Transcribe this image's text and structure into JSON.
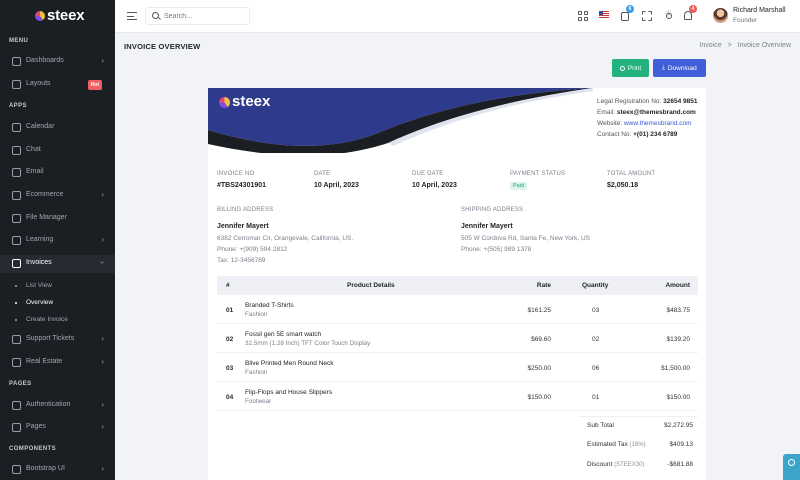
{
  "brand": {
    "name": "steex"
  },
  "sidebar": {
    "sections": [
      "MENU",
      "APPS",
      "PAGES",
      "COMPONENTS"
    ],
    "items": [
      {
        "label": "Dashboards",
        "icon": "dashboard-icon",
        "chevron": true
      },
      {
        "label": "Layouts",
        "icon": "layout-icon",
        "badge": "Hot"
      },
      {
        "label": "Calendar",
        "icon": "calendar-icon"
      },
      {
        "label": "Chat",
        "icon": "chat-icon"
      },
      {
        "label": "Email",
        "icon": "email-icon"
      },
      {
        "label": "Ecommerce",
        "icon": "cart-icon",
        "chevron": true
      },
      {
        "label": "File Manager",
        "icon": "folder-icon"
      },
      {
        "label": "Learning",
        "icon": "learning-icon",
        "chevron": true
      },
      {
        "label": "Invoices",
        "icon": "invoice-icon",
        "chevron": true,
        "active": true
      },
      {
        "label": "Support Tickets",
        "icon": "ticket-icon",
        "chevron": true
      },
      {
        "label": "Real Estate",
        "icon": "building-icon",
        "chevron": true
      },
      {
        "label": "Authentication",
        "icon": "lock-icon",
        "chevron": true
      },
      {
        "label": "Pages",
        "icon": "pages-icon",
        "chevron": true
      },
      {
        "label": "Bootstrap UI",
        "icon": "ui-icon",
        "chevron": true
      }
    ],
    "invoice_subitems": [
      "List View",
      "Overview",
      "Create Invoice"
    ],
    "active_subitem": "Overview"
  },
  "topbar": {
    "search_placeholder": "Search...",
    "cart_count": "6",
    "notification_count": "4",
    "user_name": "Richard Marshall",
    "user_role": "Founder"
  },
  "page": {
    "title": "INVOICE OVERVIEW",
    "breadcrumb": [
      "Invoice",
      ">",
      "Invoice Overview"
    ],
    "print_label": "Print",
    "download_label": "Download"
  },
  "company": {
    "reg_label": "Legal Registration No:",
    "reg_value": "32654 9851",
    "email_label": "Email:",
    "email_value": "steex@themesbrand.com",
    "website_label": "Website:",
    "website_value": "www.themesbrand.com",
    "contact_label": "Contact No:",
    "contact_value": "+(01) 234 6789"
  },
  "invoice_meta": {
    "invoice_no_label": "INVOICE NO",
    "invoice_no": "#TBS24301901",
    "date_label": "DATE",
    "date": "10 April, 2023",
    "due_label": "DUE DATE",
    "due": "10 April, 2023",
    "status_label": "PAYMENT STATUS",
    "status": "Paid",
    "total_label": "TOTAL AMOUNT",
    "total": "$2,050.18"
  },
  "billing": {
    "label": "BILLING ADDRESS",
    "name": "Jennifer Mayert",
    "address": "6382 Cerromar Cir, Orangevale, California, US.",
    "phone": "Phone: +(909) 594 2812",
    "tax": "Tax: 12-3456789"
  },
  "shipping": {
    "label": "SHIPPING ADDRESS",
    "name": "Jennifer Mayert",
    "address": "505 W Cordova Rd, Santa Fe, New York, US",
    "phone": "Phone: +(505) 989 1378"
  },
  "table": {
    "headers": [
      "#",
      "Product Details",
      "Rate",
      "Quantity",
      "Amount"
    ],
    "rows": [
      {
        "num": "01",
        "name": "Branded T-Shirts",
        "category": "Fashion",
        "rate": "$161.25",
        "qty": "03",
        "amount": "$483.75"
      },
      {
        "num": "02",
        "name": "Fossil gen 5E smart watch",
        "category": "32.5mm (1.28 Inch) TFT Color Touch Display",
        "rate": "$69.60",
        "qty": "02",
        "amount": "$139.20"
      },
      {
        "num": "03",
        "name": "Blive Printed Men Round Neck",
        "category": "Fashion",
        "rate": "$250.00",
        "qty": "06",
        "amount": "$1,500.00"
      },
      {
        "num": "04",
        "name": "Flip-Flops and House Slippers",
        "category": "Footwear",
        "rate": "$150.00",
        "qty": "01",
        "amount": "$150.00"
      }
    ]
  },
  "summary": {
    "subtotal_label": "Sub Total",
    "subtotal": "$2,272.95",
    "tax_label": "Estimated Tax",
    "tax_rate": "(18%)",
    "tax": "$409.13",
    "discount_label": "Discount",
    "discount_code": "(STEEX30)",
    "discount": "-$681.88"
  },
  "colors": {
    "sidebar_bg": "#1b1e23",
    "hero_blue": "#2e3a8c",
    "primary": "#3f5ed7",
    "success": "#22b27d"
  }
}
